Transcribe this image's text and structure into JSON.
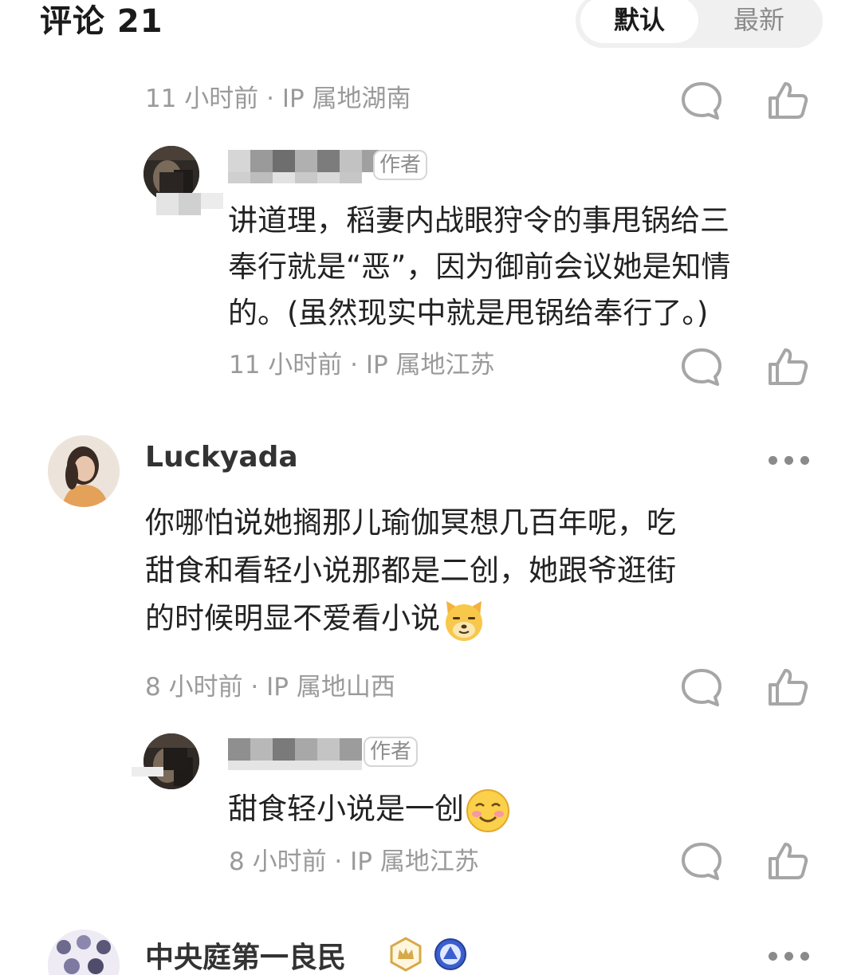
{
  "header": {
    "title": "评论 21",
    "sort": {
      "default_label": "默认",
      "latest_label": "最新",
      "selected": "默认"
    }
  },
  "comments": [
    {
      "meta": "11 小时前 · IP 属地湖南",
      "replies": [
        {
          "author_tag": "作者",
          "text": "讲道理，稻妻内战眼狩令的事甩锅给三奉行就是“恶”，因为御前会议她是知情的。(虽然现实中就是甩锅给奉行了。)",
          "text_lines": [
            "讲道理，稻妻内战眼狩令的事甩锅给三",
            "奉行就是“恶”，因为御前会议她是知情",
            "的。(虽然现实中就是甩锅给奉行了。)"
          ],
          "meta": "11 小时前 · IP 属地江苏"
        }
      ]
    },
    {
      "username": "Luckyada",
      "text_lines": [
        "你哪怕说她搁那儿瑜伽冥想几百年呢，吃",
        "甜食和看轻小说那都是二创，她跟爷逛街",
        "的时候明显不爱看小说"
      ],
      "emoji": "dog-face-emoji",
      "meta": "8 小时前 · IP 属地山西",
      "replies": [
        {
          "author_tag": "作者",
          "text": "甜食轻小说是一创",
          "emoji": "smiling-face-emoji",
          "meta": "8 小时前 · IP 属地江苏"
        }
      ]
    },
    {
      "username": "中央庭第一良民",
      "badges": [
        "crown-badge-icon",
        "level-up-badge-icon"
      ]
    }
  ],
  "colors": {
    "meta_gray": "#9a9a9a",
    "icon_gray": "#a6a6a6",
    "toggle_bg": "#f0f0f0"
  }
}
